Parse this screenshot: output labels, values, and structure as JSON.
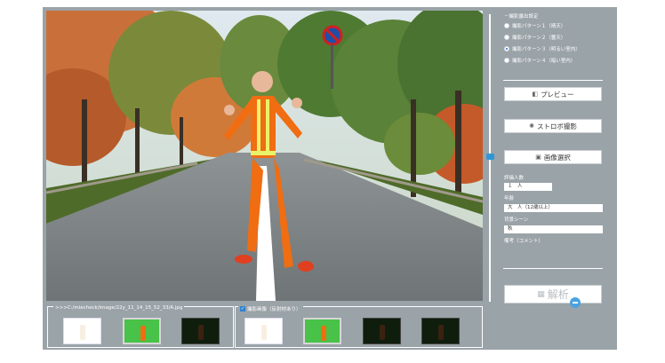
{
  "settings": {
    "title": "撮影露出設定",
    "patterns": [
      {
        "label": "撮影パターン１（晴天）",
        "selected": false
      },
      {
        "label": "撮影パターン２（曇天）",
        "selected": false
      },
      {
        "label": "撮影パターン３（明るい室内）",
        "selected": true
      },
      {
        "label": "撮影パターン４（暗い室内）",
        "selected": false
      }
    ]
  },
  "buttons": {
    "preview": "プレビュー",
    "strobe": "ストロボ撮影",
    "select_image": "画像選択",
    "analyze": "解析"
  },
  "form": {
    "count_label": "評価人数",
    "count_value": "１　人",
    "age_label": "年齢",
    "age_value": "大　人（12歳以上）",
    "scene_label": "背景シーン",
    "scene_value": "秋",
    "note_label": "備考（コメント）"
  },
  "bottom": {
    "path": ">>>C:/miecheck/image/22y_11_14_15_52_33/A.jpg",
    "checkbox_label": "撮影画像（反射材あり）",
    "checkbox_checked": true
  },
  "colors": {
    "panel_bg": "#9aa3a8",
    "accent": "#2f96d8",
    "vest": "#f06d12",
    "reflector": "#e9f36a"
  }
}
